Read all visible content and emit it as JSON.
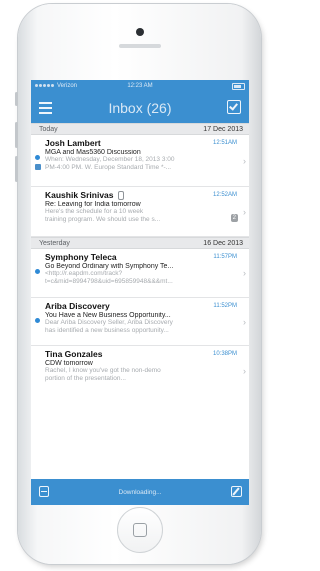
{
  "status_bar": {
    "carrier": "Verizon",
    "time": "12:23 AM"
  },
  "nav": {
    "title": "Inbox (26)"
  },
  "sections": [
    {
      "label": "Today",
      "date": "17 Dec 2013",
      "messages": [
        {
          "sender": "Josh Lambert",
          "time": "12:51AM",
          "subject": "MGA and Mas5360 Discussion",
          "preview1": "When: Wednesday, December 18, 2013 3:00",
          "preview2": "PM-4:00 PM. W. Europe Standard Time *-..."
        },
        {
          "sender": "Kaushik Srinivas",
          "time": "12:52AM",
          "subject": "Re: Leaving for India tomorrow",
          "preview1": "Here's the schedule for a 10 week",
          "preview2": "training program. We should use the s...",
          "badge": "2"
        }
      ]
    },
    {
      "label": "Yesterday",
      "date": "16 Dec 2013",
      "messages": [
        {
          "sender": "Symphony Teleca",
          "time": "11:57PM",
          "subject": "Go Beyond Ordinary with Symphony Te...",
          "preview1": "<http://r.eapdm.com/track?",
          "preview2": "t=c&mid=8994798&uid=695859948&&&mt..."
        },
        {
          "sender": "Ariba Discovery",
          "time": "11:52PM",
          "subject": "You Have a New Business Opportunity...",
          "preview1": "Dear Ariba Discovery Seller, Ariba Discovery",
          "preview2": "has identified a new business opportunity..."
        },
        {
          "sender": "Tina Gonzales",
          "time": "10:38PM",
          "subject": "CDW tomorrow",
          "preview1": "Rachel, I know you've got the non-demo",
          "preview2": "portion of the presentation..."
        }
      ]
    }
  ],
  "toolbar": {
    "status": "Downloading..."
  }
}
